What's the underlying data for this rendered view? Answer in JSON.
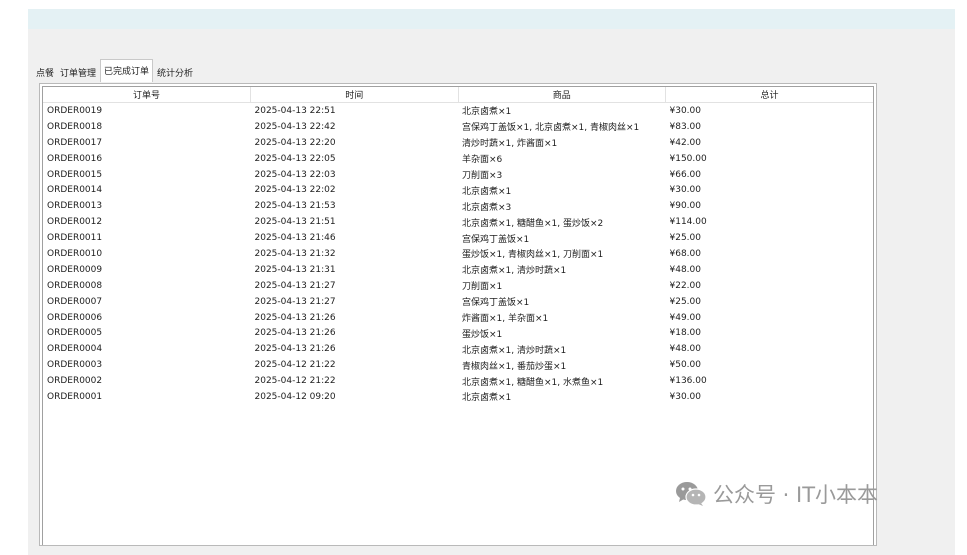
{
  "tabs": [
    {
      "label": "点餐",
      "active": false
    },
    {
      "label": "订单管理",
      "active": false
    },
    {
      "label": "已完成订单",
      "active": true
    },
    {
      "label": "统计分析",
      "active": false
    }
  ],
  "table": {
    "columns": [
      "订单号",
      "时间",
      "商品",
      "总计"
    ],
    "rows": [
      [
        "ORDER0019",
        "2025-04-13 22:51",
        "北京卤煮×1",
        "¥30.00"
      ],
      [
        "ORDER0018",
        "2025-04-13 22:42",
        "宫保鸡丁盖饭×1, 北京卤煮×1, 青椒肉丝×1",
        "¥83.00"
      ],
      [
        "ORDER0017",
        "2025-04-13 22:20",
        "清炒时蔬×1, 炸酱面×1",
        "¥42.00"
      ],
      [
        "ORDER0016",
        "2025-04-13 22:05",
        "羊杂面×6",
        "¥150.00"
      ],
      [
        "ORDER0015",
        "2025-04-13 22:03",
        "刀削面×3",
        "¥66.00"
      ],
      [
        "ORDER0014",
        "2025-04-13 22:02",
        "北京卤煮×1",
        "¥30.00"
      ],
      [
        "ORDER0013",
        "2025-04-13 21:53",
        "北京卤煮×3",
        "¥90.00"
      ],
      [
        "ORDER0012",
        "2025-04-13 21:51",
        "北京卤煮×1, 糖醋鱼×1, 蛋炒饭×2",
        "¥114.00"
      ],
      [
        "ORDER0011",
        "2025-04-13 21:46",
        "宫保鸡丁盖饭×1",
        "¥25.00"
      ],
      [
        "ORDER0010",
        "2025-04-13 21:32",
        "蛋炒饭×1, 青椒肉丝×1, 刀削面×1",
        "¥68.00"
      ],
      [
        "ORDER0009",
        "2025-04-13 21:31",
        "北京卤煮×1, 清炒时蔬×1",
        "¥48.00"
      ],
      [
        "ORDER0008",
        "2025-04-13 21:27",
        "刀削面×1",
        "¥22.00"
      ],
      [
        "ORDER0007",
        "2025-04-13 21:27",
        "宫保鸡丁盖饭×1",
        "¥25.00"
      ],
      [
        "ORDER0006",
        "2025-04-13 21:26",
        "炸酱面×1, 羊杂面×1",
        "¥49.00"
      ],
      [
        "ORDER0005",
        "2025-04-13 21:26",
        "蛋炒饭×1",
        "¥18.00"
      ],
      [
        "ORDER0004",
        "2025-04-13 21:26",
        "北京卤煮×1, 清炒时蔬×1",
        "¥48.00"
      ],
      [
        "ORDER0003",
        "2025-04-12 21:22",
        "青椒肉丝×1, 番茄炒蛋×1",
        "¥50.00"
      ],
      [
        "ORDER0002",
        "2025-04-12 21:22",
        "北京卤煮×1, 糖醋鱼×1, 水煮鱼×1",
        "¥136.00"
      ],
      [
        "ORDER0001",
        "2025-04-12 09:20",
        "北京卤煮×1",
        "¥30.00"
      ]
    ]
  },
  "watermark": {
    "icon": "wechat-icon",
    "text": "公众号 · IT小本本"
  },
  "colors": {
    "title_strip": "#e4f1f4",
    "window_bg": "#f0f0f0",
    "watermark": "#9a9a9a"
  }
}
